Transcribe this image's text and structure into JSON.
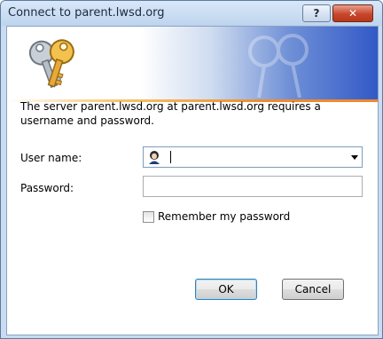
{
  "window": {
    "title": "Connect to parent.lwsd.org",
    "help_label": "?",
    "close_label": "✕"
  },
  "icons": {
    "banner_icon": "keys-icon",
    "watermark": "keys-watermark-icon",
    "user_icon": "user-account-icon",
    "dropdown": "chevron-down-icon"
  },
  "colors": {
    "banner_blue": "#3259c7",
    "banner_line": "#ef8a2c",
    "close_red": "#c8462c"
  },
  "dialog": {
    "message": "The server parent.lwsd.org at parent.lwsd.org requires a username and password.",
    "username_label": "User name:",
    "username_value": "",
    "password_label": "Password:",
    "password_value": "",
    "remember_label": "Remember my password",
    "remember_checked": false,
    "ok_label": "OK",
    "cancel_label": "Cancel"
  }
}
